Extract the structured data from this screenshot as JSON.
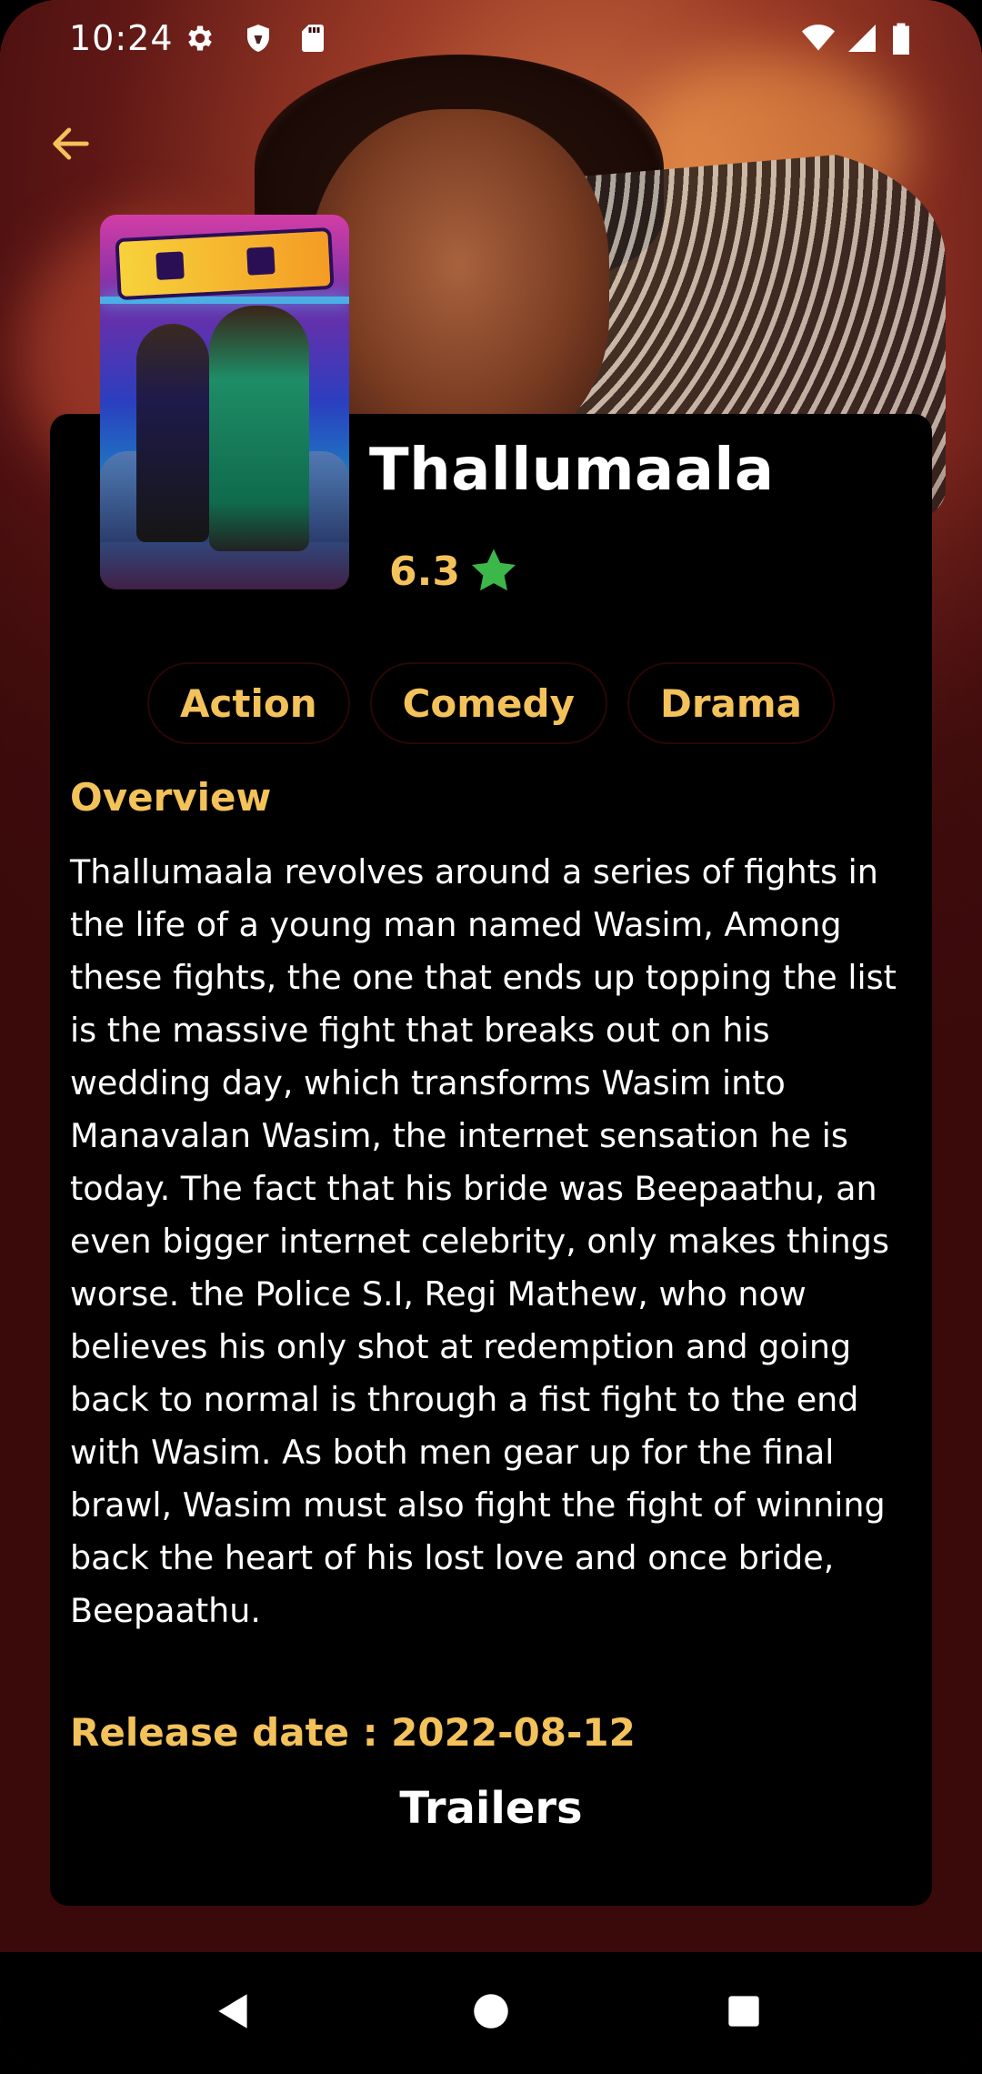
{
  "status_bar": {
    "time": "10:24",
    "icons": [
      "gear-icon",
      "shield-icon",
      "sd-card-icon",
      "wifi-icon",
      "signal-icon",
      "battery-icon"
    ]
  },
  "navigation": {
    "back_icon": "arrow-left-icon"
  },
  "movie": {
    "title": "Thallumaala",
    "rating": "6.3",
    "genres": [
      "Action",
      "Comedy",
      "Drama"
    ],
    "overview_heading": "Overview",
    "overview": "Thallumaala revolves around a series of fights in the life of a young man named Wasim, Among these fights, the one that ends up topping the list is the massive fight that breaks out on his wedding day, which transforms Wasim into Manavalan Wasim, the internet sensation he is today. The fact that his bride was Beepaathu, an even bigger internet celebrity, only makes things worse. the  Police S.I, Regi Mathew, who now believes his only shot at redemption and going back to normal is through a fist fight to the end with Wasim. As both men gear up for the final brawl, Wasim must also fight the fight of winning back the heart of his lost love and once bride, Beepaathu.",
    "release_label": "Release date : ",
    "release_date": "2022-08-12",
    "trailers_heading": "Trailers"
  },
  "colors": {
    "accent": "#f4c25a",
    "star": "#3cb84a",
    "card_background": "#000000",
    "page_background": "#3a0a0b"
  },
  "system_nav": {
    "icons": [
      "nav-back-icon",
      "nav-home-icon",
      "nav-recents-icon"
    ]
  }
}
